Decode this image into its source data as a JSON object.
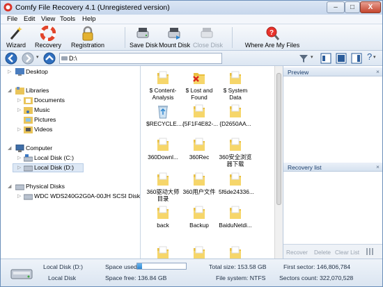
{
  "window": {
    "title": "Comfy File Recovery 4.1 (Unregistered version)",
    "minimize": "–",
    "maximize": "□",
    "close": "X"
  },
  "menu": [
    "File",
    "Edit",
    "View",
    "Tools",
    "Help"
  ],
  "toolbar": {
    "wizard": "Wizard",
    "recovery": "Recovery",
    "registration": "Registration",
    "save_disk": "Save Disk",
    "mount_disk": "Mount Disk",
    "close_disk": "Close Disk",
    "where_are_my_files": "Where Are My Files"
  },
  "address": {
    "path": "D:\\"
  },
  "tree": {
    "desktop": "Desktop",
    "libraries": "Libraries",
    "documents": "Documents",
    "music": "Music",
    "pictures": "Pictures",
    "videos": "Videos",
    "computer": "Computer",
    "local_c": "Local Disk (C:)",
    "local_d": "Local Disk (D:)",
    "physical_disks": "Physical Disks",
    "wdc": "WDC WDS240G2G0A-00JH SCSI Disk Device"
  },
  "files": [
    {
      "name": "$ Content-\nAnalysis",
      "icon": "folder-icon"
    },
    {
      "name": "$ Lost and\nFound",
      "icon": "folder-lost-icon"
    },
    {
      "name": "$ System\nData",
      "icon": "folder-icon"
    },
    {
      "name": "$RECYCLE....",
      "icon": "recycle-bin-icon"
    },
    {
      "name": "{5F1F4E82-...",
      "icon": "folder-icon"
    },
    {
      "name": "{D2650AA...",
      "icon": "folder-icon"
    },
    {
      "name": "360Downl...",
      "icon": "folder-icon"
    },
    {
      "name": "360Rec",
      "icon": "folder-icon"
    },
    {
      "name": "360安全浏览\n器下载",
      "icon": "folder-icon"
    },
    {
      "name": "360驱动大师\n目录",
      "icon": "folder-icon"
    },
    {
      "name": "360用户文件",
      "icon": "folder-icon"
    },
    {
      "name": "5f6de24336...",
      "icon": "folder-icon"
    },
    {
      "name": "back",
      "icon": "folder-icon"
    },
    {
      "name": "Backup",
      "icon": "folder-icon"
    },
    {
      "name": "BaiduNetdi...",
      "icon": "folder-icon"
    }
  ],
  "panels": {
    "preview": "Preview",
    "recovery_list": "Recovery list",
    "close": "×",
    "recover": "Recover",
    "delete": "Delete",
    "clear_list": "Clear List"
  },
  "status": {
    "disk_name": "Local Disk (D:)",
    "disk_type": "Local Disk",
    "space_used_label": "Space used:",
    "space_used_fraction": 0.1,
    "space_free": "Space free: 136.84 GB",
    "total_size": "Total size: 153.58 GB",
    "file_system": "File system: NTFS",
    "first_sector": "First sector: 146,806,784",
    "sectors_count": "Sectors count: 322,070,528"
  },
  "colors": {
    "accent": "#2f86cf",
    "frame": "#6b8fb9",
    "folder": "#f2cf5c"
  }
}
